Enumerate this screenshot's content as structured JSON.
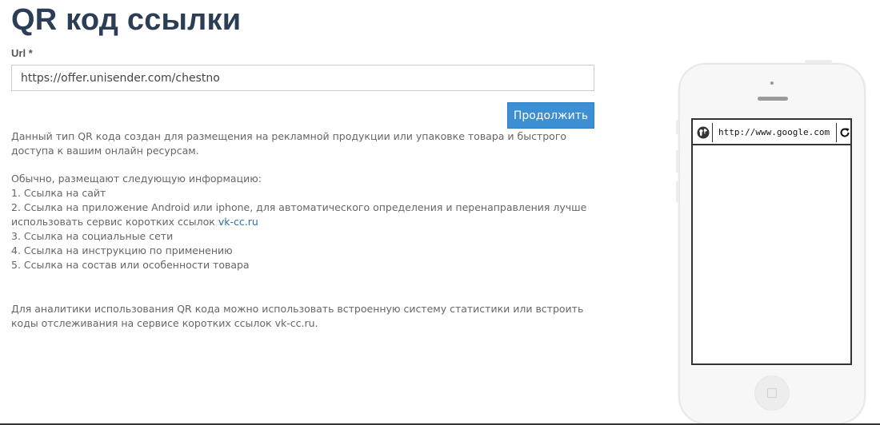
{
  "page": {
    "title": "QR код ссылки"
  },
  "form": {
    "url_label": "Url *",
    "url_value": "https://offer.unisender.com/chestno",
    "continue_label": "Продолжить"
  },
  "description": {
    "intro": "Данный тип QR кода создан для размещения на рекламной продукции или упаковке товара и быстрого доступа к вашим онлайн ресурсам.",
    "list_heading": "Обычно, размещают следующую информацию:",
    "items": {
      "item1": "1. Ссылка на сайт",
      "item2_text": "2. Ссылка на приложение Android или iphone, для автоматического определения и перенаправления лучше использовать сервис коротких ссылок ",
      "item2_link": "vk-cc.ru",
      "item3": "3. Ссылка на социальные сети",
      "item4": "4. Ссылка на инструкцию по применению",
      "item5": "5. Ссылка на состав или особенности товара"
    },
    "analytics": "Для аналитики использования QR кода можно использовать встроенную систему статистики или встроить коды отслеживания на сервисе коротких ссылок vk-cc.ru."
  },
  "phone_preview": {
    "address_url": "http://www.google.com",
    "icons": {
      "globe": "globe-icon",
      "refresh": "refresh-icon",
      "home": "home-button-icon"
    }
  },
  "colors": {
    "title": "#2c3e55",
    "button": "#3c8fd3",
    "link": "#2a6fb3",
    "text": "#666666"
  }
}
